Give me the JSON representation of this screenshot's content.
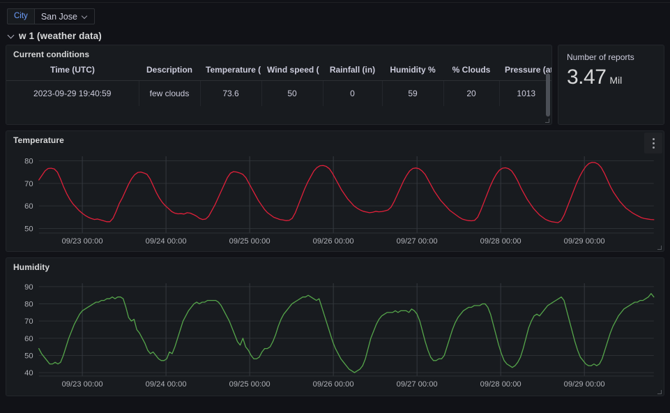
{
  "variables": {
    "city": {
      "label": "City",
      "value": "San Jose",
      "chevron_icon": "chevron-down-icon"
    }
  },
  "row": {
    "title": "w 1 (weather data)",
    "chevron_icon": "chevron-down-icon",
    "expanded": true
  },
  "panels": {
    "table": {
      "title": "Current conditions",
      "columns": [
        "Time (UTC)",
        "Description",
        "Temperature (",
        "Wind speed (",
        "Rainfall (in)",
        "Humidity %",
        "% Clouds",
        "Pressure (atm"
      ],
      "rows": [
        [
          "2023-09-29 19:40:59",
          "few clouds",
          "73.6",
          "50",
          "0",
          "59",
          "20",
          "1013"
        ]
      ]
    },
    "stat": {
      "title": "Number of reports",
      "value": "3.47",
      "unit": "Mil"
    },
    "temperature": {
      "title": "Temperature",
      "menu_icon": "kebab-menu-icon"
    },
    "humidity": {
      "title": "Humidity"
    }
  },
  "colors": {
    "page_background": "#111217",
    "panel_background": "#181b1f",
    "panel_border": "#23262b",
    "text": "#ccccdc",
    "variable_label": "#6e9fff",
    "temperature_line": "#e0203a",
    "humidity_line": "#56a64b",
    "gridline": "#2c3034"
  },
  "chart_data": [
    {
      "type": "line",
      "title": "Temperature",
      "xlabel": "",
      "ylabel": "",
      "ylim": [
        48,
        82
      ],
      "yticks": [
        50,
        60,
        70,
        80
      ],
      "xticks": [
        "09/23 00:00",
        "09/24 00:00",
        "09/25 00:00",
        "09/26 00:00",
        "09/27 00:00",
        "09/28 00:00",
        "09/29 00:00"
      ],
      "grid": true,
      "legend": "none",
      "line_color": "#e0203a",
      "series": [
        {
          "name": "Temperature",
          "values": [
            71.5,
            73.5,
            75.5,
            76.6,
            76.7,
            76.4,
            75.0,
            72.0,
            68.5,
            65.5,
            63.0,
            61.0,
            59.5,
            58.0,
            56.8,
            55.8,
            55.0,
            54.4,
            54.0,
            54.2,
            53.8,
            53.4,
            53.0,
            53.0,
            54.5,
            57.5,
            61.0,
            63.5,
            66.5,
            69.5,
            72.0,
            73.8,
            74.8,
            75.0,
            74.6,
            74.0,
            72.0,
            69.0,
            66.0,
            63.5,
            61.5,
            60.0,
            58.8,
            57.5,
            56.8,
            56.5,
            56.6,
            56.4,
            57.0,
            56.8,
            56.2,
            55.5,
            54.5,
            54.0,
            54.2,
            55.5,
            58.0,
            60.5,
            63.5,
            66.5,
            69.5,
            72.5,
            74.5,
            75.2,
            75.0,
            74.6,
            74.0,
            72.5,
            70.0,
            67.5,
            65.0,
            62.5,
            60.5,
            58.5,
            57.0,
            56.0,
            55.0,
            54.5,
            54.0,
            53.8,
            53.5,
            53.6,
            54.5,
            57.0,
            60.5,
            64.0,
            67.5,
            70.5,
            73.0,
            75.5,
            77.0,
            77.8,
            77.9,
            77.5,
            76.5,
            74.5,
            72.0,
            69.5,
            67.0,
            65.0,
            63.0,
            61.5,
            60.0,
            59.0,
            58.2,
            57.6,
            57.3,
            57.0,
            57.2,
            57.6,
            57.4,
            57.5,
            57.8,
            58.2,
            59.5,
            62.0,
            65.0,
            68.0,
            71.0,
            73.5,
            75.5,
            76.6,
            76.8,
            76.5,
            75.5,
            74.0,
            71.5,
            69.0,
            66.5,
            64.5,
            62.5,
            61.0,
            59.5,
            58.0,
            57.0,
            56.0,
            55.0,
            54.2,
            53.8,
            53.5,
            53.4,
            53.6,
            55.0,
            58.0,
            61.5,
            65.0,
            68.5,
            71.5,
            74.0,
            75.8,
            76.7,
            76.9,
            76.5,
            75.5,
            73.5,
            71.0,
            68.0,
            65.5,
            63.0,
            61.0,
            59.0,
            57.5,
            56.0,
            55.0,
            54.0,
            53.4,
            53.0,
            52.8,
            52.6,
            53.5,
            56.0,
            59.5,
            63.0,
            66.5,
            70.0,
            73.0,
            75.5,
            77.5,
            78.8,
            79.3,
            79.2,
            78.5,
            77.0,
            74.5,
            71.5,
            68.5,
            66.0,
            64.0,
            62.0,
            60.5,
            59.0,
            58.0,
            57.0,
            56.2,
            55.5,
            54.8,
            54.4,
            54.2,
            54.0,
            53.9
          ]
        }
      ]
    },
    {
      "type": "line",
      "title": "Humidity",
      "xlabel": "",
      "ylabel": "",
      "ylim": [
        38,
        92
      ],
      "yticks": [
        40,
        50,
        60,
        70,
        80,
        90
      ],
      "xticks": [
        "09/23 00:00",
        "09/24 00:00",
        "09/25 00:00",
        "09/26 00:00",
        "09/27 00:00",
        "09/28 00:00",
        "09/29 00:00"
      ],
      "grid": true,
      "legend": "none",
      "line_color": "#56a64b",
      "series": [
        {
          "name": "Humidity",
          "values": [
            54,
            51,
            49,
            47,
            45,
            45,
            46,
            45,
            46,
            50,
            55,
            60,
            64,
            68,
            71,
            74,
            76,
            77,
            78,
            79,
            80,
            81,
            81,
            82,
            82,
            83,
            83,
            84,
            83,
            84,
            84,
            83,
            78,
            72,
            70,
            71,
            65,
            63,
            60,
            57,
            53,
            51,
            52,
            50,
            48,
            47,
            47,
            48,
            52,
            51,
            55,
            60,
            65,
            70,
            73,
            76,
            78,
            80,
            81,
            80,
            81,
            81,
            82,
            82,
            82,
            82,
            81,
            79,
            76,
            73,
            70,
            66,
            62,
            58,
            56,
            60,
            55,
            53,
            50,
            48,
            48,
            49,
            52,
            54,
            54,
            55,
            58,
            62,
            67,
            71,
            74,
            76,
            78,
            80,
            81,
            82,
            83,
            84,
            84,
            85,
            84,
            83,
            82,
            83,
            78,
            73,
            68,
            63,
            58,
            54,
            51,
            48,
            46,
            44,
            42,
            41,
            40,
            41,
            42,
            44,
            48,
            54,
            60,
            64,
            68,
            71,
            73,
            74,
            75,
            75,
            75,
            76,
            75,
            76,
            76,
            76,
            75,
            77,
            76,
            74,
            70,
            64,
            58,
            53,
            49,
            47,
            47,
            48,
            48,
            50,
            55,
            60,
            65,
            69,
            72,
            74,
            76,
            77,
            78,
            78,
            79,
            79,
            79,
            80,
            80,
            78,
            74,
            68,
            62,
            56,
            51,
            47,
            45,
            44,
            43,
            44,
            46,
            49,
            54,
            60,
            66,
            70,
            73,
            74,
            73,
            75,
            77,
            79,
            80,
            81,
            82,
            83,
            84,
            82,
            76,
            70,
            64,
            58,
            53,
            49,
            47,
            45,
            44,
            44,
            45,
            44,
            45,
            48,
            53,
            58,
            63,
            67,
            70,
            73,
            75,
            77,
            78,
            79,
            80,
            81,
            81,
            82,
            82,
            83,
            84,
            86,
            84
          ]
        }
      ]
    }
  ]
}
